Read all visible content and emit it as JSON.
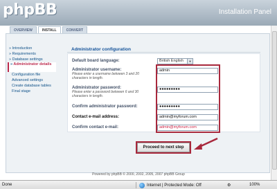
{
  "header": {
    "logo": "phpBB",
    "panel_title": "Installation Panel"
  },
  "tabs": [
    {
      "label": "OVERVIEW"
    },
    {
      "label": "INSTALL"
    },
    {
      "label": "CONVERT"
    }
  ],
  "sidebar": {
    "items": [
      {
        "label": "Introduction"
      },
      {
        "label": "Requirements"
      },
      {
        "label": "Database settings"
      },
      {
        "label": "Administrator details"
      },
      {
        "label": "Configuration file"
      },
      {
        "label": "Advanced settings"
      },
      {
        "label": "Create database tables"
      },
      {
        "label": "Final stage"
      }
    ]
  },
  "form": {
    "title": "Administrator configuration",
    "language": {
      "label": "Default board language:",
      "value": "British English"
    },
    "username": {
      "label": "Administrator username:",
      "hint": "Please enter a username between 3 and 20 characters in length.",
      "value": "admin"
    },
    "password": {
      "label": "Administrator password:",
      "hint": "Please enter a password between 6 and 30 characters in length.",
      "value": "●●●●●●●●●"
    },
    "confirm_password": {
      "label": "Confirm administrator password:",
      "value": "●●●●●●●●●"
    },
    "email": {
      "label": "Contact e-mail address:",
      "value": "admin@myforum.com"
    },
    "confirm_email": {
      "label": "Confirm contact e-mail:",
      "value": "admin@myforum.com"
    },
    "submit_label": "Proceed to next step"
  },
  "footer": {
    "text": "Powered by phpBB © 2000, 2002, 2005, 2007 phpBB Group"
  },
  "statusbar": {
    "status": "Done",
    "zone": "Internet | Protected Mode: Off",
    "zoom": "100%"
  },
  "colors": {
    "accent": "#a8283c",
    "link": "#105289"
  }
}
